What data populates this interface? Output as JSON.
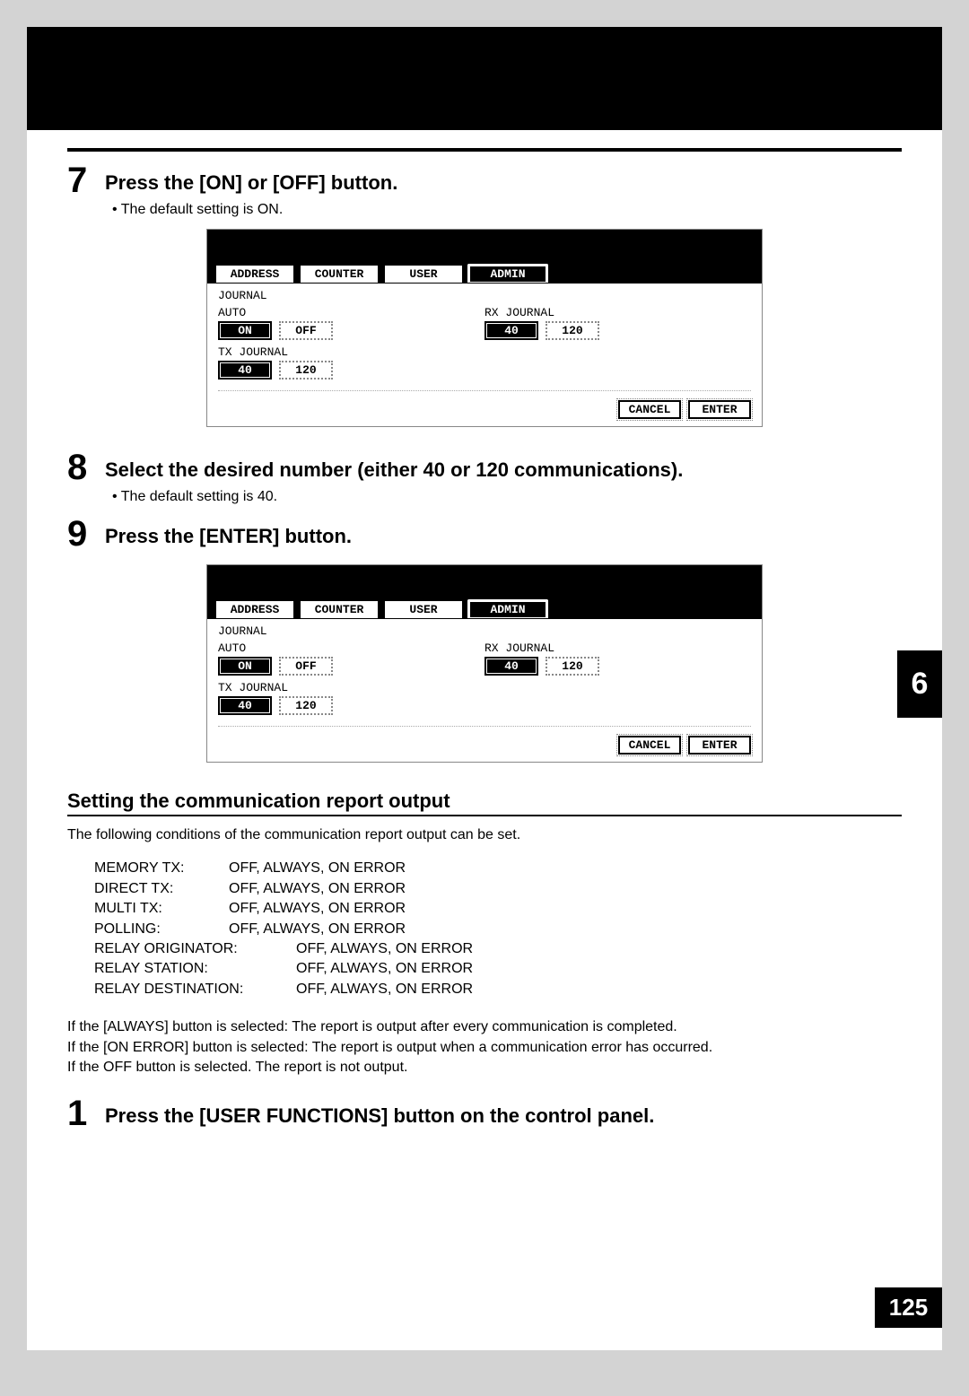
{
  "steps": {
    "s7": {
      "num": "7",
      "title": "Press the [ON] or [OFF] button.",
      "bullet": "The default setting is ON."
    },
    "s8": {
      "num": "8",
      "title": "Select the desired number (either 40 or 120 communications).",
      "bullet": "The default setting is 40."
    },
    "s9": {
      "num": "9",
      "title": "Press the [ENTER] button."
    },
    "s1": {
      "num": "1",
      "title": "Press the [USER FUNCTIONS] button on the control panel."
    }
  },
  "screenshot": {
    "tabs": {
      "address": "ADDRESS",
      "counter": "COUNTER",
      "user": "USER",
      "admin": "ADMIN"
    },
    "labels": {
      "journal": "JOURNAL",
      "auto": "AUTO",
      "tx": "TX JOURNAL",
      "rx": "RX JOURNAL"
    },
    "buttons": {
      "on": "ON",
      "off": "OFF",
      "b40": "40",
      "b120": "120",
      "cancel": "CANCEL",
      "enter": "ENTER"
    }
  },
  "section": {
    "heading": "Setting the communication report output",
    "intro": "The following conditions of the communication report output can be set.",
    "options": [
      {
        "label": "MEMORY TX:",
        "values": "OFF, ALWAYS, ON ERROR",
        "wide": false
      },
      {
        "label": "DIRECT TX:",
        "values": "OFF, ALWAYS, ON ERROR",
        "wide": false
      },
      {
        "label": "MULTI TX:",
        "values": "OFF, ALWAYS, ON ERROR",
        "wide": false
      },
      {
        "label": "POLLING:",
        "values": "OFF, ALWAYS, ON ERROR",
        "wide": false
      },
      {
        "label": "RELAY ORIGINATOR:",
        "values": "OFF, ALWAYS, ON ERROR",
        "wide": true
      },
      {
        "label": "RELAY STATION:",
        "values": "OFF, ALWAYS, ON ERROR",
        "wide": true
      },
      {
        "label": "RELAY DESTINATION:",
        "values": "OFF, ALWAYS, ON ERROR",
        "wide": true
      }
    ],
    "notes": [
      "If the [ALWAYS] button is selected: The report is output after every communication is completed.",
      "If the [ON ERROR] button is selected: The report is output when a communication error has occurred.",
      "If the OFF button is selected. The report is not output."
    ]
  },
  "sideTab": "6",
  "pageNumber": "125"
}
